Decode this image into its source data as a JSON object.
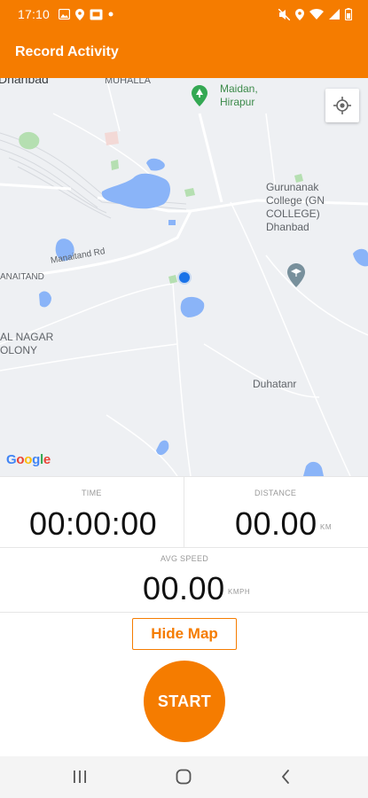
{
  "status_bar": {
    "time": "17:10",
    "left_icons": [
      "image-icon",
      "location-icon",
      "screen-icon",
      "dot-icon"
    ],
    "right_icons": [
      "mute-icon",
      "location-icon",
      "wifi-icon",
      "signal-icon",
      "battery-icon"
    ]
  },
  "app_bar": {
    "title": "Record Activity",
    "color": "#f57c00"
  },
  "map": {
    "labels": {
      "dhanbad": "Dhanbad",
      "muhalla": "MUHALLA",
      "maidan_line1": "Maidan,",
      "maidan_line2": "Hirapur",
      "gurunanak_line1": "Gurunanak",
      "gurunanak_line2": "College (GN",
      "gurunanak_line3": "COLLEGE)",
      "gurunanak_line4": "Dhanbad",
      "manaitand_rd": "Manaitand Rd",
      "anaitand": "ANAITAND",
      "nagar_line1": "AL NAGAR",
      "nagar_line2": "OLONY",
      "duhatanr": "Duhatanr"
    },
    "google_logo": {
      "G": "G",
      "o1": "o",
      "o2": "o",
      "g": "g",
      "l": "l",
      "e": "e"
    },
    "locate_icon": "my-location-icon"
  },
  "stats": {
    "time_label": "TIME",
    "time_value": "00:00:00",
    "distance_label": "DISTANCE",
    "distance_value": "00.00",
    "distance_unit": "KM",
    "speed_label": "AVG SPEED",
    "speed_value": "00.00",
    "speed_unit": "KMPH"
  },
  "buttons": {
    "hide_map": "Hide Map",
    "start": "START"
  },
  "nav_bar": {
    "icons": [
      "recents-icon",
      "home-icon",
      "back-icon"
    ]
  },
  "colors": {
    "accent": "#f57c00",
    "water": "#8ab4f8",
    "park": "#b5dfb1",
    "location_dot": "#1a73e8"
  }
}
